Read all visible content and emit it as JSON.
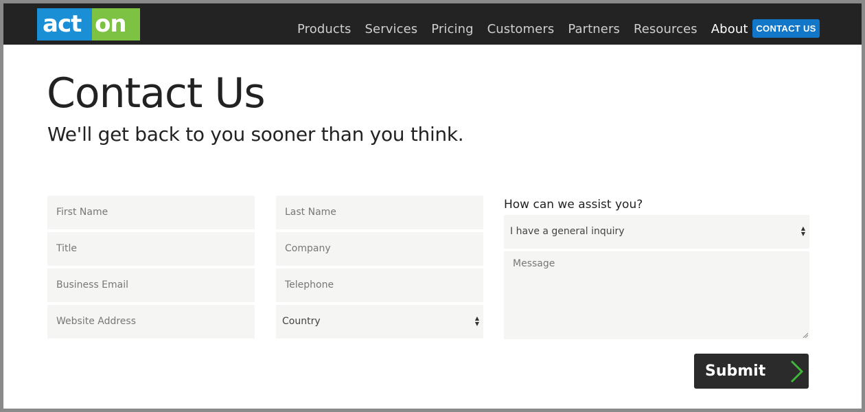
{
  "brand": {
    "logo_left": "act",
    "logo_right": "on",
    "blue": "#1a8fd6",
    "green": "#7dc242"
  },
  "nav": {
    "items": [
      {
        "label": "Products"
      },
      {
        "label": "Services"
      },
      {
        "label": "Pricing"
      },
      {
        "label": "Customers"
      },
      {
        "label": "Partners"
      },
      {
        "label": "Resources"
      },
      {
        "label": "About"
      }
    ],
    "contact_label": "CONTACT US",
    "contact_color": "#1277c9"
  },
  "page": {
    "title": "Contact Us",
    "subtitle": "We'll get back to you sooner than you think."
  },
  "form": {
    "first_name": "First Name",
    "last_name": "Last Name",
    "title": "Title",
    "company": "Company",
    "business_email": "Business Email",
    "telephone": "Telephone",
    "website": "Website Address",
    "country": "Country",
    "assist_label": "How can we assist you?",
    "inquiry": "I have a general inquiry",
    "message": "Message",
    "submit": "Submit",
    "submit_arrow_color": "#3fb53a"
  }
}
